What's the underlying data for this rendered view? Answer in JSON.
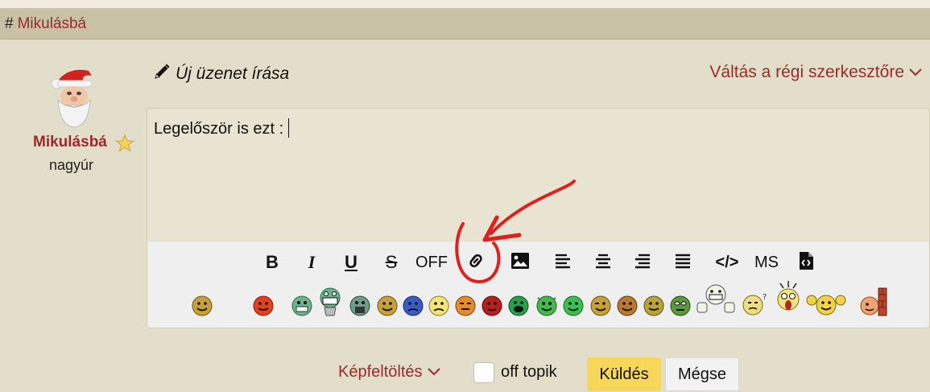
{
  "breadcrumb": {
    "hash": "#",
    "title": "Mikulásbá"
  },
  "user": {
    "name": "Mikulásbá",
    "rank": "nagyúr"
  },
  "editor": {
    "new_message_label": "Új üzenet írása",
    "switch_label": "Váltás a régi szerkesztőre",
    "content": "Legelőször is ezt  :"
  },
  "toolbar": {
    "bold": "B",
    "italic": "I",
    "underline": "U",
    "strike": "S",
    "off": "OFF",
    "ms": "MS",
    "code": "</>"
  },
  "bottom": {
    "upload_label": "Képfeltöltés",
    "off_topic_label": "off topik",
    "send_label": "Küldés",
    "cancel_label": "Mégse"
  },
  "colors": {
    "accent": "#9b2a2a",
    "annotation": "#e0201d",
    "send_button": "#f6d75a"
  },
  "icons": {
    "pencil": "pencil-icon",
    "chevron": "chevron-down-icon",
    "link": "link-icon",
    "image": "image-icon",
    "align_left": "align-left-icon",
    "align_center": "align-center-icon",
    "align_right": "align-right-icon",
    "justify": "justify-icon",
    "file_code": "file-code-icon",
    "star": "star-icon"
  }
}
